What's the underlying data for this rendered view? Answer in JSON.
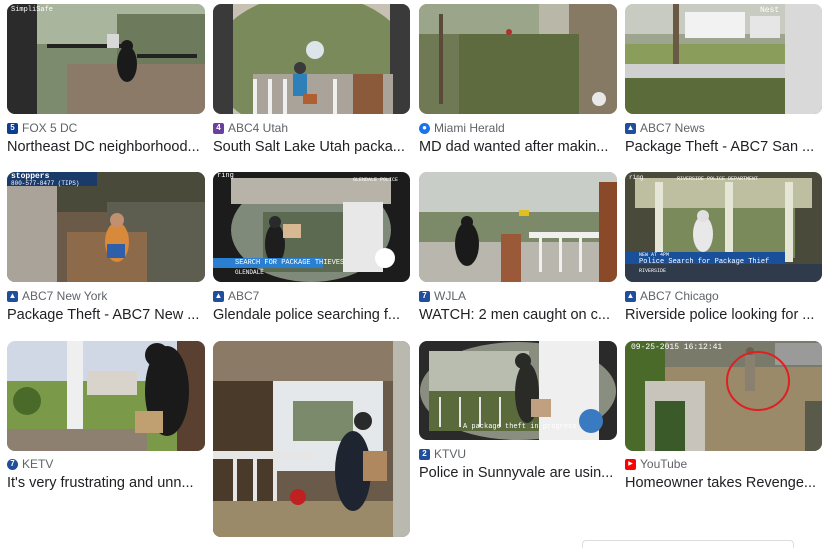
{
  "results": [
    {
      "source": "FOX 5 DC",
      "title": "Northeast DC neighborhood...",
      "fav_color": "#0b3d91",
      "fav_glyph": "5",
      "fav_icon": "fox5-icon",
      "overlay": "SimpliSafe"
    },
    {
      "source": "ABC4 Utah",
      "title": "South Salt Lake Utah packa...",
      "fav_color": "#6a3fa0",
      "fav_glyph": "4",
      "fav_icon": "abc4-icon",
      "overlay": ""
    },
    {
      "source": "Miami Herald",
      "title": "MD dad wanted after makin...",
      "fav_color": "#1a73e8",
      "fav_glyph": "●",
      "fav_icon": "globe-icon",
      "overlay": ""
    },
    {
      "source": "ABC7 News",
      "title": "Package Theft - ABC7 San ...",
      "fav_color": "#1f4e9c",
      "fav_glyph": "▲",
      "fav_icon": "abc7-icon",
      "overlay": "Nest"
    },
    {
      "source": "ABC7 New York",
      "title": "Package Theft - ABC7 New ...",
      "fav_color": "#1f4e9c",
      "fav_glyph": "▲",
      "fav_icon": "abc7-icon",
      "overlay": "800-577-8477 (TIPS)",
      "overlay2": "stoppers"
    },
    {
      "source": "ABC7",
      "title": "Glendale police searching f...",
      "fav_color": "#1f4e9c",
      "fav_glyph": "▲",
      "fav_icon": "abc7-icon",
      "overlay": "SEARCH FOR PACKAGE THIEVES",
      "overlay2": "GLENDALE",
      "overlay3": "ring",
      "overlay4": "GLENDALE POLICE"
    },
    {
      "source": "WJLA",
      "title": "WATCH: 2 men caught on c...",
      "fav_color": "#1f4e9c",
      "fav_glyph": "7",
      "fav_icon": "wjla-icon",
      "overlay": ""
    },
    {
      "source": "ABC7 Chicago",
      "title": "Riverside police looking for ...",
      "fav_color": "#1f4e9c",
      "fav_glyph": "▲",
      "fav_icon": "abc7-icon",
      "overlay": "Police Search for Package Thief",
      "overlay2": "NEW AT 4PM",
      "overlay3": "RIVERSIDE",
      "overlay4": "ring",
      "overlay5": "RIVERSIDE POLICE DEPARTMENT"
    },
    {
      "source": "KETV",
      "title": "It's very frustrating and unn...",
      "fav_color": "#1f4e9c",
      "fav_glyph": "7",
      "fav_icon": "ketv-icon",
      "overlay": ""
    },
    {
      "source": "",
      "title": "",
      "fav_color": "#1f4e9c",
      "fav_glyph": "",
      "fav_icon": "",
      "overlay": ""
    },
    {
      "source": "KTVU",
      "title": "Police in Sunnyvale are usin...",
      "fav_color": "#1f4e9c",
      "fav_glyph": "2",
      "fav_icon": "ktvu-icon",
      "overlay": "A package theft in progress"
    },
    {
      "source": "YouTube",
      "title": "Homeowner takes Revenge...",
      "fav_color": "#ff0000",
      "fav_glyph": "▶",
      "fav_icon": "youtube-icon",
      "overlay": "09-25-2015 16:12:41"
    }
  ]
}
